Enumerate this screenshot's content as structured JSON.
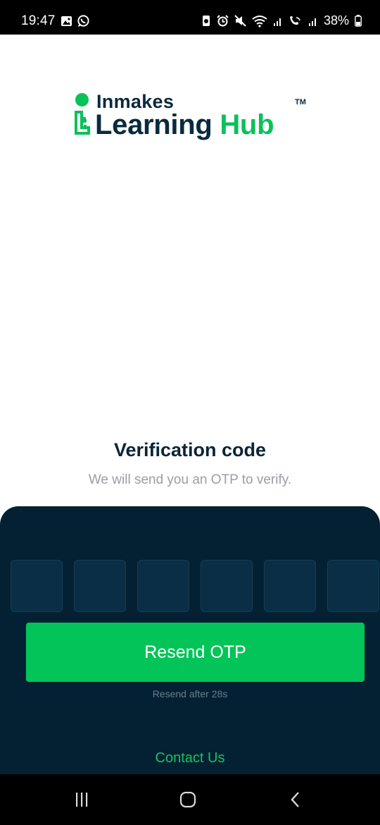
{
  "status_bar": {
    "time": "19:47",
    "battery": "38%",
    "left_icons": [
      "gallery-icon",
      "whatsapp-icon"
    ],
    "right_icons": [
      "data-saver-icon",
      "alarm-icon",
      "mute-icon",
      "wifi-icon",
      "signal-icon",
      "wifi-call-icon",
      "signal-icon",
      "battery-icon"
    ]
  },
  "logo": {
    "top_word": "Inmakes",
    "learning": "Learning",
    "hub": "Hub",
    "tm": "TM"
  },
  "verification": {
    "title": "Verification code",
    "subtitle": "We will send you an OTP to verify."
  },
  "otp": {
    "boxes": [
      "",
      "",
      "",
      "",
      "",
      ""
    ]
  },
  "actions": {
    "resend_label": "Resend OTP",
    "resend_timer": "Resend after 28s",
    "contact_label": "Contact Us"
  },
  "nav_bar": {
    "buttons": [
      "recent-apps-icon",
      "home-icon",
      "back-icon"
    ]
  },
  "colors": {
    "brand_green": "#02c458",
    "brand_navy": "#0a2a3d",
    "panel": "#032133"
  }
}
